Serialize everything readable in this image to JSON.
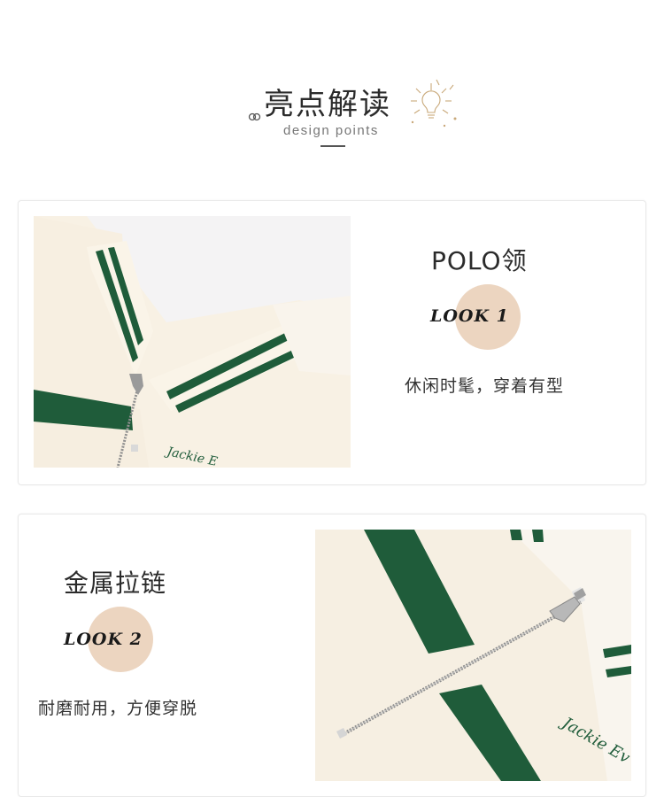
{
  "header": {
    "title": "亮点解读",
    "subtitle": "design points"
  },
  "features": [
    {
      "title": "POLO领",
      "badge": "LOOK 1",
      "description": "休闲时髦，穿着有型",
      "image_icon": "polo-collar-photo",
      "image_text": "Jackie E"
    },
    {
      "title": "金属拉链",
      "badge": "LOOK 2",
      "description": "耐磨耐用，方便穿脱",
      "image_icon": "metal-zipper-photo",
      "image_text": "Jackie Ev"
    }
  ],
  "colors": {
    "accent_circle": "#ecd5c0",
    "garment_cream": "#f7efe0",
    "stripe_green": "#1f5c3a"
  }
}
